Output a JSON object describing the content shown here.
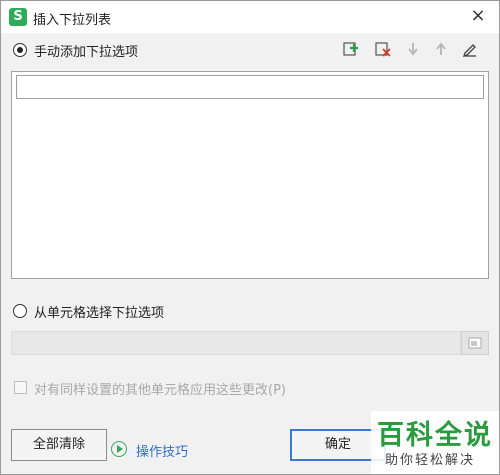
{
  "window": {
    "title": "插入下拉列表",
    "app_icon_letter": "S",
    "close_glyph": "×"
  },
  "manual_section": {
    "label": "手动添加下拉选项",
    "selected": true,
    "toolbar": [
      {
        "name": "add-item",
        "icon": "add-item-icon"
      },
      {
        "name": "delete-item",
        "icon": "delete-item-icon"
      },
      {
        "name": "move-down",
        "icon": "arrow-down-icon"
      },
      {
        "name": "move-up",
        "icon": "arrow-up-icon"
      },
      {
        "name": "edit-item",
        "icon": "pencil-icon"
      }
    ],
    "items": [
      {
        "value": ""
      }
    ]
  },
  "cell_section": {
    "label": "从单元格选择下拉选项",
    "selected": false,
    "range_value": ""
  },
  "apply_all": {
    "label": "对有同样设置的其他单元格应用这些更改(P)",
    "checked": false,
    "enabled": false
  },
  "buttons": {
    "clear_all": "全部清除",
    "confirm": "确定"
  },
  "tips_link": "操作技巧",
  "watermark": {
    "title": "百科全说",
    "subtitle": "助你轻松解决"
  },
  "colors": {
    "accent_blue": "#3b78d4",
    "link_blue": "#2f6fd0",
    "brand_green": "#2eac5a"
  }
}
